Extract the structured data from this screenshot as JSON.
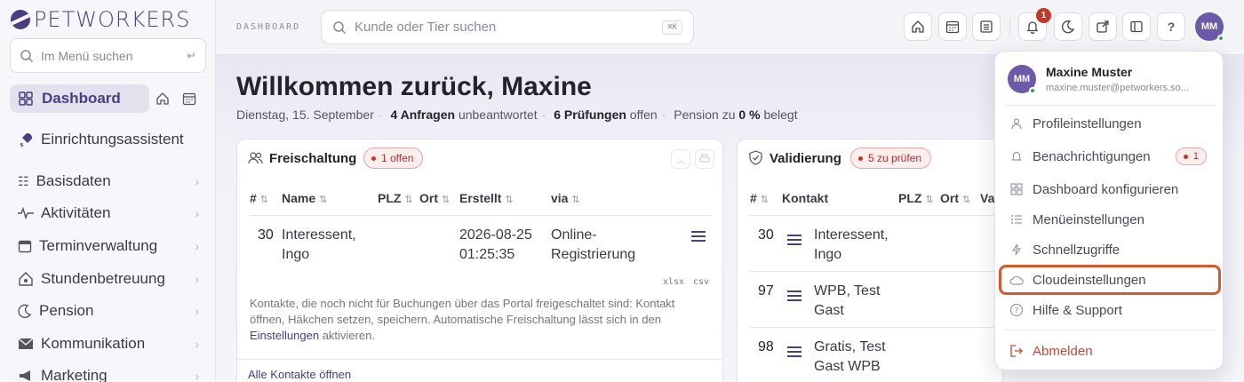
{
  "brand": {
    "name": "PETWORKERS"
  },
  "sidebar": {
    "search_placeholder": "Im Menü suchen",
    "search_hint": "↵",
    "dashboard_label": "Dashboard",
    "setup_label": "Einrichtungsassistent",
    "items": [
      {
        "label": "Basisdaten",
        "icon": "person-list-icon"
      },
      {
        "label": "Aktivitäten",
        "icon": "activity-icon"
      },
      {
        "label": "Terminverwaltung",
        "icon": "calendar-icon"
      },
      {
        "label": "Stundenbetreuung",
        "icon": "house-paw-icon"
      },
      {
        "label": "Pension",
        "icon": "moon-icon"
      },
      {
        "label": "Kommunikation",
        "icon": "envelope-icon"
      },
      {
        "label": "Marketing",
        "icon": "megaphone-icon"
      }
    ]
  },
  "topbar": {
    "breadcrumb": "DASHBOARD",
    "search_placeholder": "Kunde oder Tier suchen",
    "search_shortcut": "⌘K",
    "notification_count": "1",
    "help_label": "?",
    "avatar_initials": "MM"
  },
  "header": {
    "title": "Willkommen zurück, Maxine",
    "date": "Dienstag, 15. September",
    "requests_count": "4 Anfragen",
    "requests_text": "unbeantwortet",
    "checks_count": "6 Prüfungen",
    "checks_text": "offen",
    "pension_text": "Pension zu",
    "pension_value": "0 %",
    "pension_suffix": "belegt"
  },
  "freischaltung": {
    "title": "Freischaltung",
    "badge": "1 offen",
    "columns": [
      "#",
      "Name",
      "PLZ",
      "Ort",
      "Erstellt",
      "via"
    ],
    "rows": [
      {
        "id": "30",
        "name_line1": "Interessent,",
        "name_line2": "Ingo",
        "created_line1": "2026-08-25",
        "created_line2": "01:25:35",
        "via_line1": "Online-",
        "via_line2": "Registrierung"
      }
    ],
    "export_xlsx": "xlsx",
    "export_csv": "csv",
    "help_text": "Kontakte, die noch nicht für Buchungen über das Portal freigeschaltet sind: Kontakt öffnen, Häkchen setzen, speichern. Automatische Freischaltung lässt sich in den",
    "help_link": "Einstellungen",
    "help_suffix": "aktivieren.",
    "open_all": "Alle Kontakte öffnen"
  },
  "validierung": {
    "title": "Validierung",
    "badge": "5 zu prüfen",
    "columns": [
      "#",
      "Kontakt",
      "PLZ",
      "Ort",
      "Va"
    ],
    "rows": [
      {
        "id": "30",
        "line1": "Interessent,",
        "line2": "Ingo"
      },
      {
        "id": "97",
        "line1": "WPB, Test",
        "line2": "Gast"
      },
      {
        "id": "98",
        "line1": "Gratis, Test",
        "line2": "Gast WPB"
      }
    ]
  },
  "user_menu": {
    "initials": "MM",
    "name": "Maxine Muster",
    "email": "maxine.muster@petworkers.so...",
    "items": [
      {
        "label": "Profileinstellungen",
        "icon": "person-icon"
      },
      {
        "label": "Benachrichtigungen",
        "icon": "bell-icon",
        "badge": "1"
      },
      {
        "label": "Dashboard konfigurieren",
        "icon": "grid-icon"
      },
      {
        "label": "Menüeinstellungen",
        "icon": "list-icon"
      },
      {
        "label": "Schnellzugriffe",
        "icon": "lightning-icon"
      },
      {
        "label": "Cloudeinstellungen",
        "icon": "cloud-icon"
      },
      {
        "label": "Hilfe & Support",
        "icon": "help-circle-icon"
      }
    ],
    "logout": "Abmelden"
  },
  "colors": {
    "accent": "#4a3d82",
    "highlight_outline": "#d4592b",
    "badge_red": "#c0392b"
  }
}
